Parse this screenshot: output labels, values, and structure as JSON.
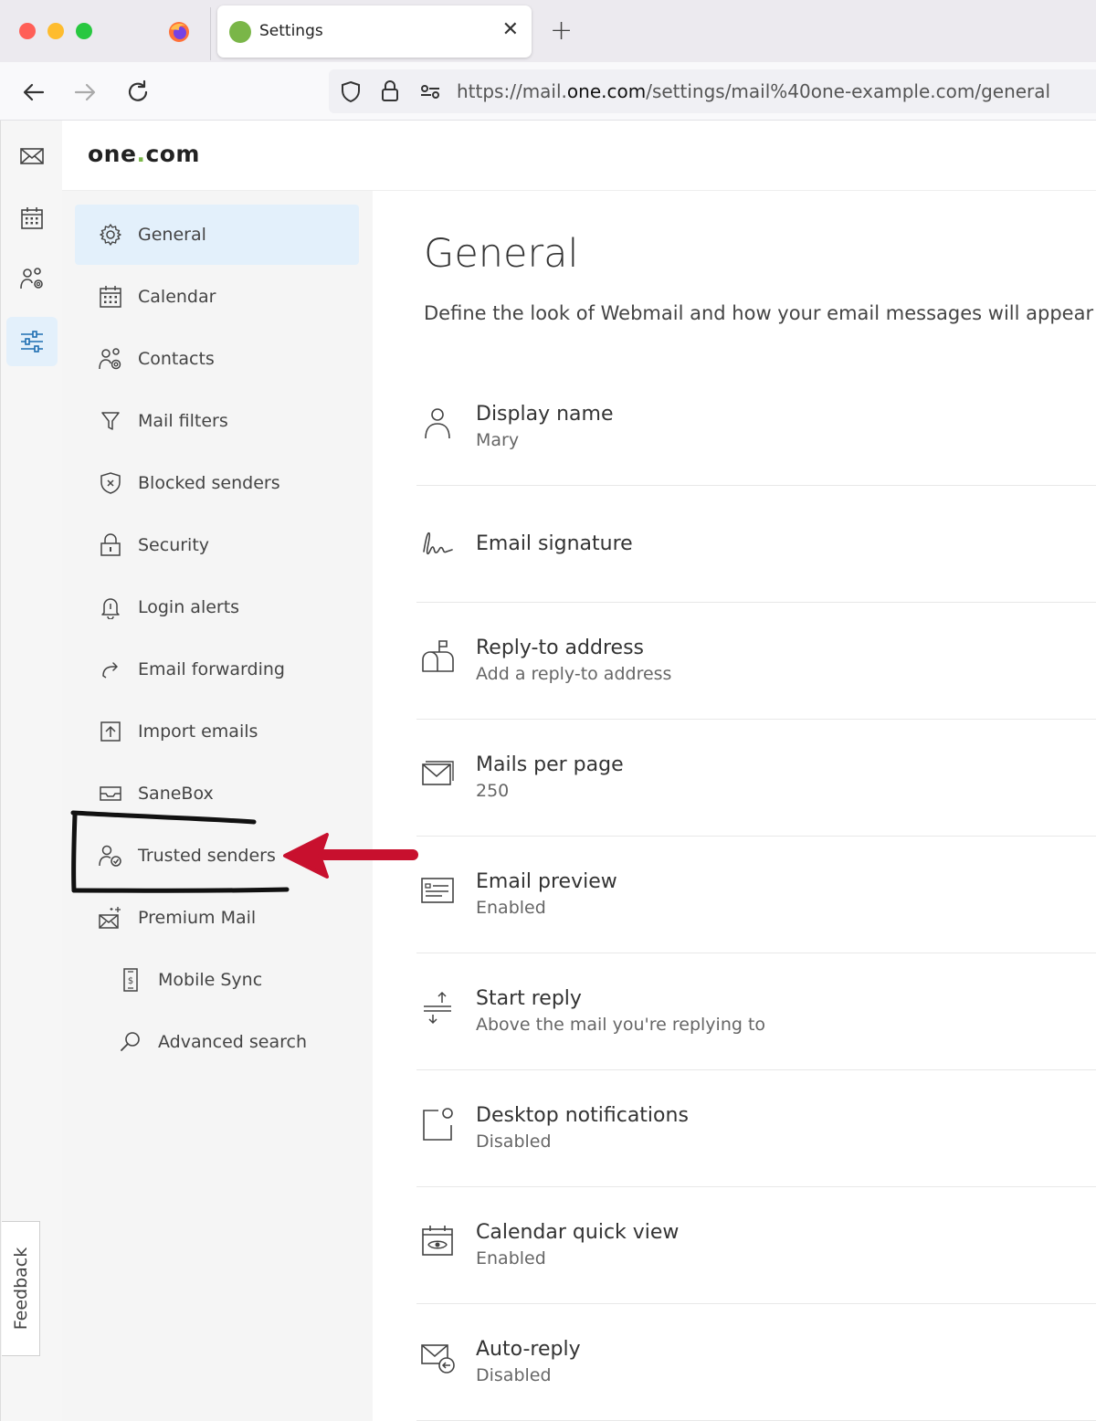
{
  "browser": {
    "tab_title": "Settings",
    "url_prefix": "https://mail.",
    "url_domain": "one.com",
    "url_path": "/settings/mail%40one-example.com/general"
  },
  "app": {
    "logo_text": "one",
    "logo_dot": ".",
    "logo_suffix": "com",
    "feedback_label": "Feedback"
  },
  "sidebar": {
    "items": [
      {
        "label": "General"
      },
      {
        "label": "Calendar"
      },
      {
        "label": "Contacts"
      },
      {
        "label": "Mail filters"
      },
      {
        "label": "Blocked senders"
      },
      {
        "label": "Security"
      },
      {
        "label": "Login alerts"
      },
      {
        "label": "Email forwarding"
      },
      {
        "label": "Import emails"
      },
      {
        "label": "SaneBox"
      },
      {
        "label": "Trusted senders"
      },
      {
        "label": "Premium Mail"
      },
      {
        "label": "Mobile Sync"
      },
      {
        "label": "Advanced search"
      }
    ]
  },
  "main": {
    "title": "General",
    "description": "Define the look of Webmail and how your email messages will appear",
    "settings": [
      {
        "title": "Display name",
        "value": "Mary"
      },
      {
        "title": "Email signature",
        "value": ""
      },
      {
        "title": "Reply-to address",
        "value": "Add a reply-to address"
      },
      {
        "title": "Mails per page",
        "value": "250"
      },
      {
        "title": "Email preview",
        "value": "Enabled"
      },
      {
        "title": "Start reply",
        "value": "Above the mail you're replying to"
      },
      {
        "title": "Desktop notifications",
        "value": "Disabled"
      },
      {
        "title": "Calendar quick view",
        "value": "Enabled"
      },
      {
        "title": "Auto-reply",
        "value": "Disabled"
      }
    ]
  },
  "colors": {
    "accent_active": "#e3f0fb",
    "brand_green": "#7ab648",
    "annotation_red": "#c8102e"
  }
}
